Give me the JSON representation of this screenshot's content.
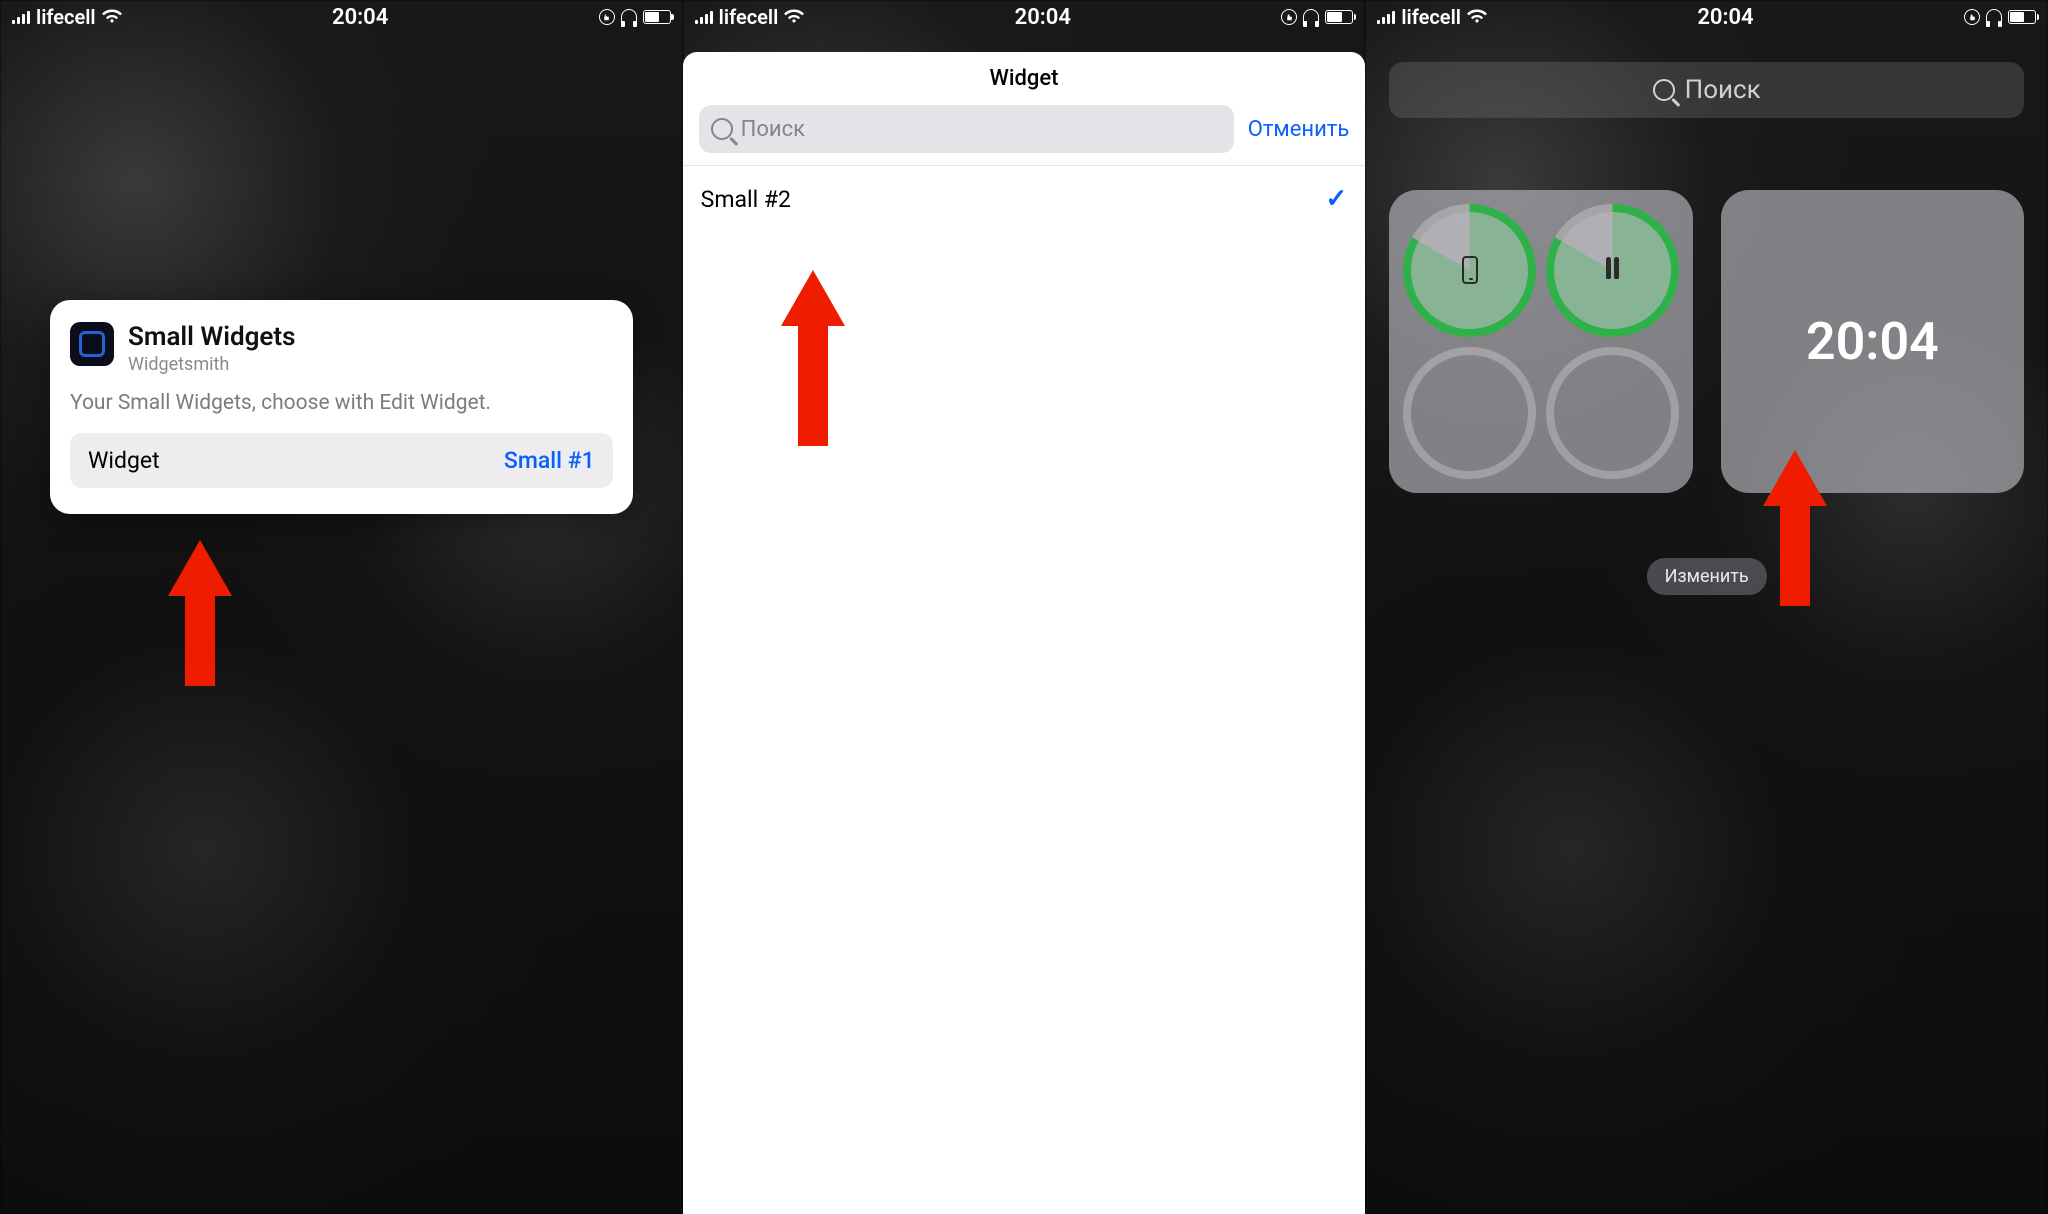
{
  "status": {
    "carrier": "lifecell",
    "time": "20:04"
  },
  "screen1": {
    "card": {
      "title": "Small Widgets",
      "subtitle": "Widgetsmith",
      "description": "Your Small Widgets, choose with Edit Widget.",
      "row_label": "Widget",
      "row_value": "Small #1"
    }
  },
  "screen2": {
    "nav_title": "Widget",
    "search_placeholder": "Поиск",
    "cancel": "Отменить",
    "item": "Small #2"
  },
  "screen3": {
    "search_placeholder": "Поиск",
    "clock": "20:04",
    "edit": "Изменить"
  }
}
